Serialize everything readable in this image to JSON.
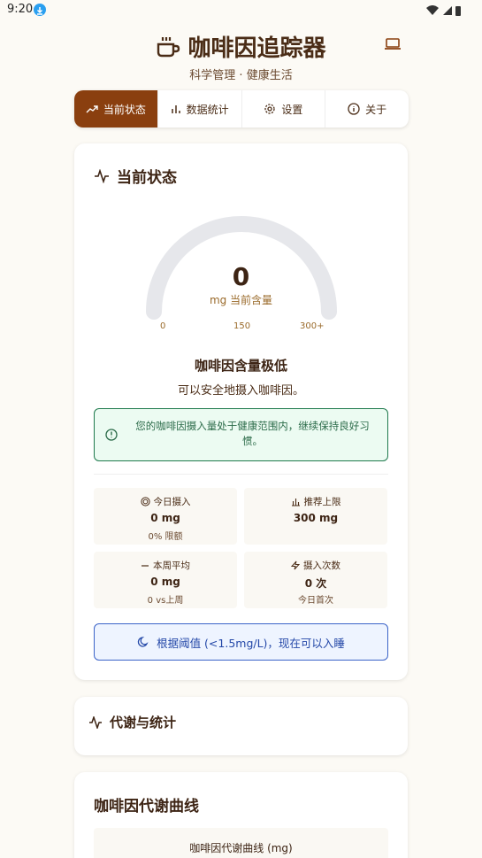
{
  "status_bar": {
    "time": "9:20"
  },
  "header": {
    "title": "咖啡因追踪器",
    "subtitle": "科学管理 · 健康生活"
  },
  "tabs": [
    {
      "label": "当前状态",
      "icon": "trending-up-icon",
      "active": true
    },
    {
      "label": "数据统计",
      "icon": "bar-chart-icon",
      "active": false
    },
    {
      "label": "设置",
      "icon": "gear-icon",
      "active": false
    },
    {
      "label": "关于",
      "icon": "info-icon",
      "active": false
    }
  ],
  "status_card": {
    "title": "当前状态",
    "gauge": {
      "value": "0",
      "unit": "mg 当前含量",
      "min_label": "0",
      "mid_label": "150",
      "max_label": "300+",
      "fill_fraction": 0
    },
    "level_title": "咖啡因含量极低",
    "level_desc": "可以安全地摄入咖啡因。",
    "alert": "您的咖啡因摄入量处于健康范围内，继续保持良好习惯。",
    "stats": [
      {
        "label": "今日摄入",
        "value": "0 mg",
        "sub": "0% 限额",
        "icon": "target-icon"
      },
      {
        "label": "推荐上限",
        "value": "300 mg",
        "sub": "",
        "icon": "bar-chart-icon"
      },
      {
        "label": "本周平均",
        "value": "0 mg",
        "sub": "0 vs上周",
        "icon": "minus-icon"
      },
      {
        "label": "摄入次数",
        "value": "0 次",
        "sub": "今日首次",
        "icon": "zap-icon"
      }
    ],
    "sleep_text": "根据阈值 (<1.5mg/L)，现在可以入睡"
  },
  "metabolism_card": {
    "title": "代谢与统计"
  },
  "curve_card": {
    "title": "咖啡因代谢曲线",
    "chart_title": "咖啡因代谢曲线 (mg)"
  },
  "colors": {
    "accent": "#8a3f0f",
    "alert_green": "#1f7a4d",
    "sleep_blue": "#3b63c8",
    "gauge_track": "#e6e7eb"
  }
}
